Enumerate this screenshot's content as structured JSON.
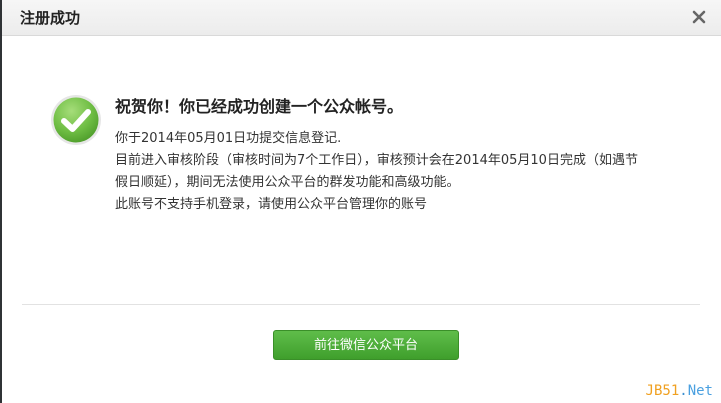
{
  "dialog": {
    "title": "注册成功",
    "close_icon": "close-icon"
  },
  "message": {
    "icon": "check-circle-icon",
    "headline": "祝贺你！你已经成功创建一个公众帐号。",
    "lines": [
      "你于2014年05月01日功提交信息登记.",
      "目前进入审核阶段（审核时间为7个工作日），审核预计会在2014年05月10日完成（如遇节",
      "假日顺延），期间无法使用公众平台的群发功能和高级功能。",
      "此账号不支持手机登录，请使用公众平台管理你的账号"
    ]
  },
  "actions": {
    "primary_label": "前往微信公众平台"
  },
  "watermark": {
    "part1": "JB51",
    "part2": ".",
    "part3": "Net"
  },
  "colors": {
    "accent": "#4aac36",
    "header_bg": "#f2f2f2"
  }
}
